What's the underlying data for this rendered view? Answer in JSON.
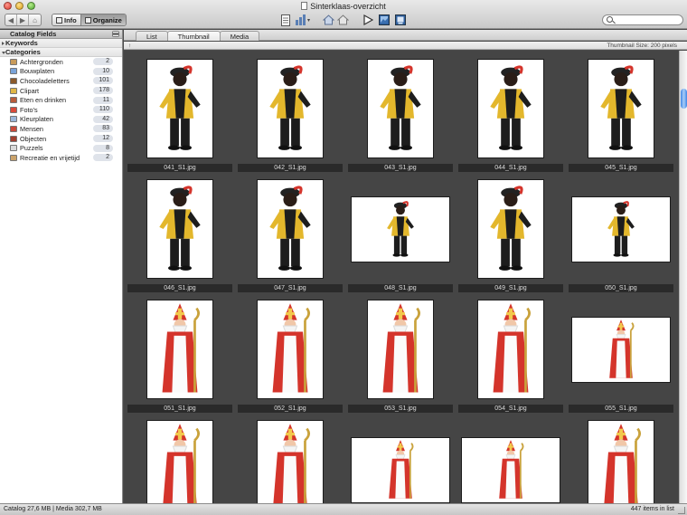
{
  "window": {
    "title": "Sinterklaas-overzicht"
  },
  "toolbar": {
    "info_label": "Info",
    "organize_label": "Organize",
    "search_placeholder": ""
  },
  "sidebar": {
    "header": "Catalog Fields",
    "keywords_label": "Keywords",
    "categories_label": "Categories",
    "categories": [
      {
        "label": "Achtergronden",
        "count": "2",
        "icon_color": "#c79a5a"
      },
      {
        "label": "Bouwplaten",
        "count": "10",
        "icon_color": "#7aa3d8"
      },
      {
        "label": "Chocoladeletters",
        "count": "101",
        "icon_color": "#8b5a2b"
      },
      {
        "label": "Clipart",
        "count": "178",
        "icon_color": "#e0b646"
      },
      {
        "label": "Eten en drinken",
        "count": "11",
        "icon_color": "#b85c3b"
      },
      {
        "label": "Foto's",
        "count": "110",
        "icon_color": "#d94a3a"
      },
      {
        "label": "Kleurplaten",
        "count": "42",
        "icon_color": "#9ab6d9"
      },
      {
        "label": "Mensen",
        "count": "83",
        "icon_color": "#c84a3a"
      },
      {
        "label": "Objecten",
        "count": "12",
        "icon_color": "#a04030"
      },
      {
        "label": "Puzzels",
        "count": "8",
        "icon_color": "#d9d9d9"
      },
      {
        "label": "Recreatie en vrijetijd",
        "count": "2",
        "icon_color": "#caa26a"
      }
    ]
  },
  "tabs": [
    {
      "label": "List",
      "active": false
    },
    {
      "label": "Thumbnail",
      "active": true
    },
    {
      "label": "Media",
      "active": false
    }
  ],
  "view": {
    "sort_indicator": "↑",
    "thumbnail_size_label": "Thumbnail Size: 200 pixels"
  },
  "thumbnails": [
    {
      "file": "041_S1.jpg",
      "kind": "piet",
      "orient": "portrait"
    },
    {
      "file": "042_S1.jpg",
      "kind": "piet",
      "orient": "portrait"
    },
    {
      "file": "043_S1.jpg",
      "kind": "piet",
      "orient": "portrait"
    },
    {
      "file": "044_S1.jpg",
      "kind": "piet",
      "orient": "portrait"
    },
    {
      "file": "045_S1.jpg",
      "kind": "piet",
      "orient": "portrait"
    },
    {
      "file": "046_S1.jpg",
      "kind": "piet",
      "orient": "portrait"
    },
    {
      "file": "047_S1.jpg",
      "kind": "piet",
      "orient": "portrait"
    },
    {
      "file": "048_S1.jpg",
      "kind": "piet",
      "orient": "landscape"
    },
    {
      "file": "049_S1.jpg",
      "kind": "piet",
      "orient": "portrait"
    },
    {
      "file": "050_S1.jpg",
      "kind": "piet",
      "orient": "landscape"
    },
    {
      "file": "051_S1.jpg",
      "kind": "sint",
      "orient": "portrait"
    },
    {
      "file": "052_S1.jpg",
      "kind": "sint",
      "orient": "portrait"
    },
    {
      "file": "053_S1.jpg",
      "kind": "sint",
      "orient": "portrait"
    },
    {
      "file": "054_S1.jpg",
      "kind": "sint",
      "orient": "portrait"
    },
    {
      "file": "055_S1.jpg",
      "kind": "sint",
      "orient": "landscape"
    },
    {
      "file": "",
      "kind": "sint",
      "orient": "portrait"
    },
    {
      "file": "",
      "kind": "sint",
      "orient": "portrait"
    },
    {
      "file": "",
      "kind": "sint",
      "orient": "landscape"
    },
    {
      "file": "",
      "kind": "sint",
      "orient": "landscape"
    },
    {
      "file": "",
      "kind": "sint",
      "orient": "portrait"
    }
  ],
  "status": {
    "left": "Catalog  27,6 MB  |  Media 302,7 MB",
    "right": "447 items in list"
  }
}
